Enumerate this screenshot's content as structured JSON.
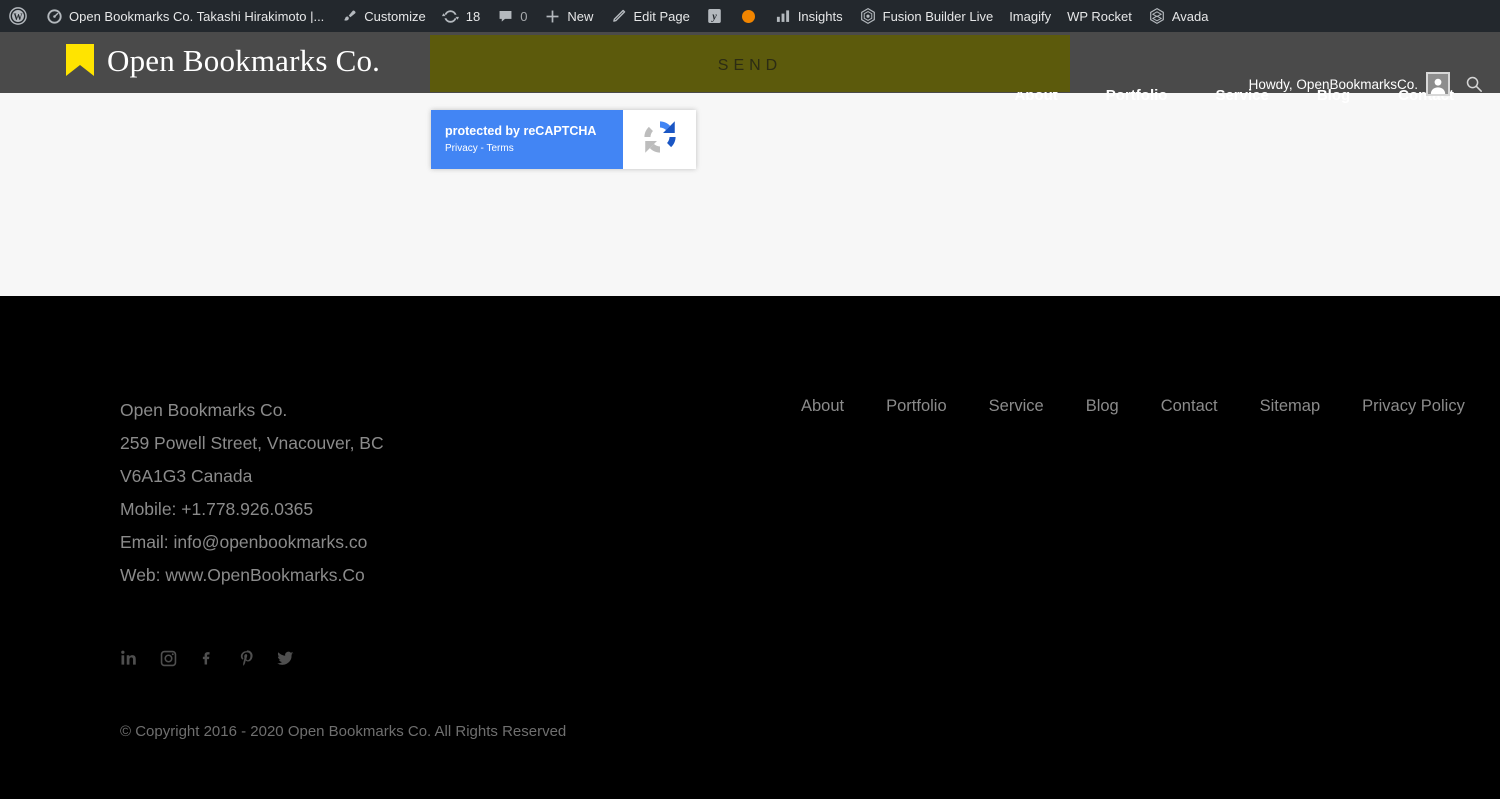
{
  "colors": {
    "admin_bar_bg": "#23282d",
    "header_bg": "#4a4a4a",
    "accent_olive": "#5c5a0c",
    "logo_yellow": "#ffe400",
    "content_bg": "#f7f7f7",
    "footer_bg": "#000000",
    "recaptcha_blue": "#4285f4",
    "orange_dot": "#f18500"
  },
  "admin_bar": {
    "wp_logo": "wordpress-logo-icon",
    "items": [
      {
        "icon": "dashboard-icon",
        "label": "Open Bookmarks Co. Takashi Hirakimoto |..."
      },
      {
        "icon": "brush-icon",
        "label": "Customize"
      },
      {
        "icon": "update-icon",
        "label": "18"
      },
      {
        "icon": "comment-bubble-icon",
        "label": "0"
      },
      {
        "icon": "plus-icon",
        "label": "New"
      },
      {
        "icon": "pencil-icon",
        "label": "Edit Page"
      },
      {
        "icon": "yoast-icon",
        "label": ""
      },
      {
        "icon": "orange-dot-icon",
        "label": ""
      },
      {
        "icon": "bar-chart-icon",
        "label": "Insights"
      },
      {
        "icon": "fusion-builder-icon",
        "label": "Fusion Builder Live"
      },
      {
        "icon": "",
        "label": "Imagify"
      },
      {
        "icon": "",
        "label": "WP Rocket"
      },
      {
        "icon": "avada-icon",
        "label": "Avada"
      }
    ]
  },
  "header": {
    "logo_icon": "bookmark-icon",
    "logo_text": "Open Bookmarks Co.",
    "send_button_label": "SEND",
    "nav": [
      {
        "label": "About",
        "active": true
      },
      {
        "label": "Portfolio",
        "active": false
      },
      {
        "label": "Service",
        "active": false
      },
      {
        "label": "Blog",
        "active": false
      },
      {
        "label": "Contact",
        "active": false
      }
    ],
    "howdy_text": "Howdy, OpenBookmarksCo.",
    "avatar": "user-avatar-icon",
    "search_icon": "search-icon"
  },
  "main": {
    "recaptcha": {
      "title": "protected by reCAPTCHA",
      "links": "Privacy - Terms",
      "icon": "recaptcha-logo-icon"
    }
  },
  "footer": {
    "address": [
      "Open Bookmarks Co.",
      "259 Powell Street, Vnacouver, BC",
      "V6A1G3 Canada",
      "Mobile: +1.778.926.0365",
      "Email: info@openbookmarks.co",
      "Web: www.OpenBookmarks.Co"
    ],
    "links": [
      "About",
      "Portfolio",
      "Service",
      "Blog",
      "Contact",
      "Sitemap",
      "Privacy Policy"
    ],
    "social": [
      "linkedin-icon",
      "instagram-icon",
      "facebook-icon",
      "pinterest-icon",
      "twitter-icon"
    ],
    "copyright": "© Copyright 2016 - 2020  Open Bookmarks Co. All Rights Reserved"
  }
}
